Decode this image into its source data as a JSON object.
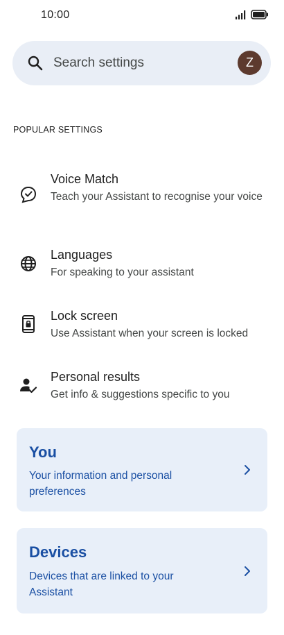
{
  "status_bar": {
    "time": "10:00",
    "icons": [
      "signal-icon",
      "battery-icon"
    ]
  },
  "search": {
    "placeholder": "Search settings",
    "avatar_letter": "Z",
    "avatar_color": "#5d3a2e"
  },
  "popular": {
    "section_title": "POPULAR SETTINGS",
    "items": [
      {
        "title": "Voice Match",
        "subtitle": "Teach your Assistant to recognise your voice",
        "icon": "voice-match-icon"
      },
      {
        "title": "Languages",
        "subtitle": "For speaking to your assistant",
        "icon": "globe-icon"
      },
      {
        "title": "Lock screen",
        "subtitle": "Use Assistant when your screen is locked",
        "icon": "lock-screen-icon"
      },
      {
        "title": "Personal results",
        "subtitle": "Get info & suggestions specific to you",
        "icon": "personal-results-icon"
      }
    ]
  },
  "cards": [
    {
      "title": "You",
      "description": "Your information and personal preferences"
    },
    {
      "title": "Devices",
      "description": "Devices that are linked to your Assistant"
    }
  ],
  "colors": {
    "card_background": "#e8eff9",
    "card_text": "#1a4fa3",
    "search_background": "#e9eef6"
  }
}
